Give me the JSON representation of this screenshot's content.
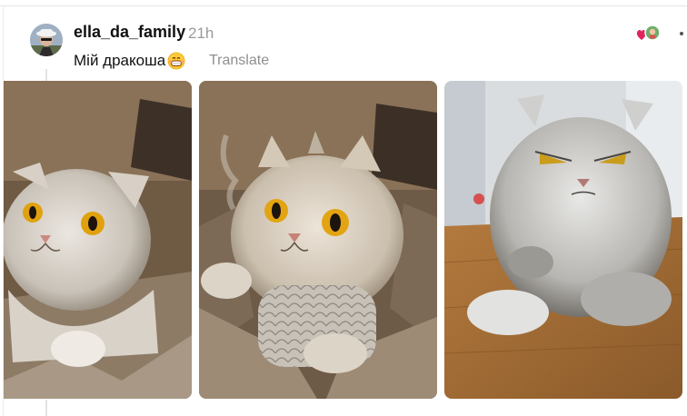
{
  "post": {
    "author": "ella_da_family",
    "time": "21h",
    "text": "Мій дракоша",
    "emoji": "grinning-face-emoji",
    "translate_label": "Translate"
  },
  "icons": {
    "reactions": "heart-and-avatar-icon",
    "more": "more-options-icon"
  },
  "photos": [
    {
      "subject": "cat-photo"
    },
    {
      "subject": "dragon-cat-illustration"
    },
    {
      "subject": "grumpy-cat-photo"
    }
  ],
  "colors": {
    "heart": "#e0245e",
    "muted_text": "#999999"
  }
}
